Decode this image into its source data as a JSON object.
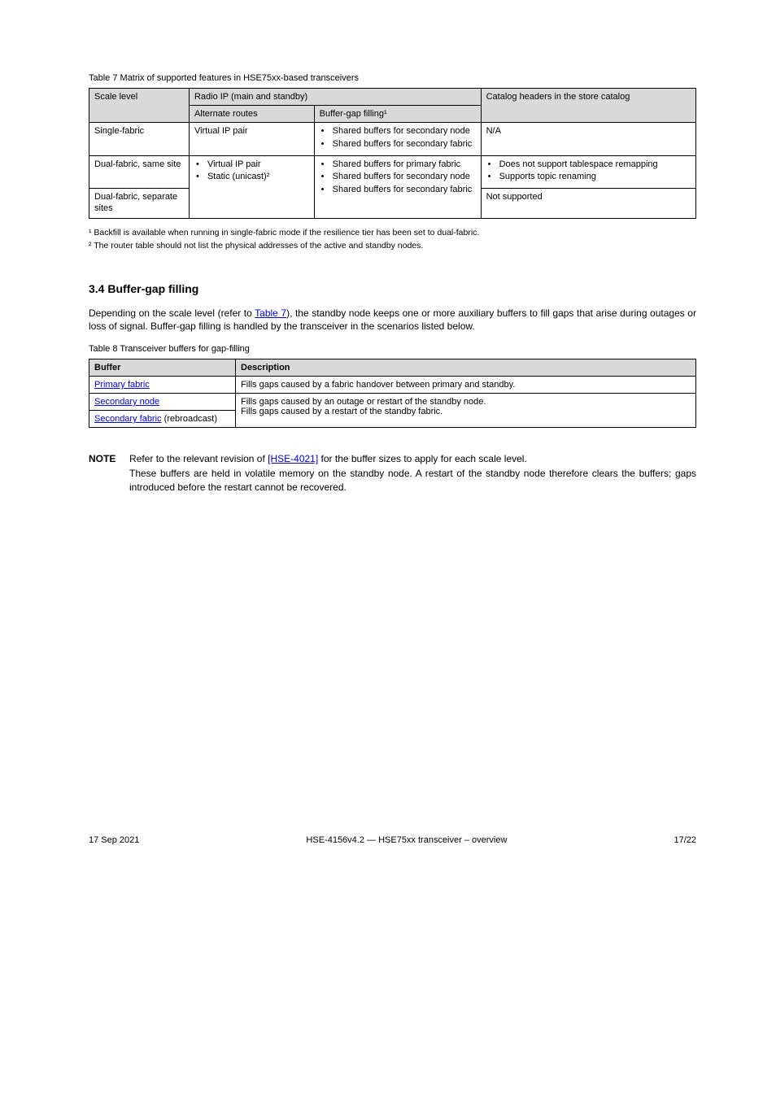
{
  "table7": {
    "caption": "Table 7 Matrix of supported features in HSE75xx-based transceivers",
    "headers": {
      "scale": "Scale level",
      "radio_group": "Radio IP (main and standby)",
      "alt_routes": "Alternate routes",
      "buf_gap": "Buffer-gap filling¹",
      "catalog_hdrs": "Catalog headers in the store catalog"
    },
    "rows": [
      {
        "scale": "Single-fabric",
        "alt_routes": "Virtual IP pair",
        "buf_gap_items": [
          "Shared buffers for secondary node",
          "Shared buffers for secondary fabric"
        ],
        "catalog": "N/A"
      },
      {
        "scale": "Dual-fabric, same site",
        "alt_routes_items": [
          "Virtual IP pair",
          "Static (unicast)²"
        ],
        "buf_gap_items": [
          "Shared buffers for primary fabric",
          "Shared buffers for secondary node",
          "Shared buffers for secondary fabric"
        ],
        "catalog_items": [
          "Does not support tablespace remapping",
          "Supports topic renaming"
        ]
      },
      {
        "scale": "Dual-fabric, separate sites",
        "catalog": "Not supported"
      }
    ]
  },
  "footnotes": {
    "fn1": "¹   Backfill is available when running in single-fabric mode if the resilience tier has been set to dual-fabric.",
    "fn2": "²   The router table should not list the physical addresses of the active and standby nodes."
  },
  "section": {
    "heading": "3.4   Buffer-gap filling",
    "p1_prefix": "Depending on the scale level (refer to ",
    "p1_link": "Table 7",
    "p1_suffix": "), the standby node keeps one or more auxiliary buffers to fill gaps that arise during outages or loss of signal. Buffer-gap filling is handled by the transceiver in the scenarios listed below."
  },
  "table8": {
    "caption": "Table 8 Transceiver buffers for gap-filling",
    "headers": {
      "buffer": "Buffer",
      "descr": "Description"
    },
    "rows": [
      {
        "buffer_link": "Primary fabric",
        "descr": "Fills gaps caused by a fabric handover between primary and standby."
      },
      {
        "buffer_link": "Secondary node",
        "descr_pre": "Fills gaps caused by an outage or restart of the standby node.",
        "buffer2_link": "Secondary fabric",
        "buffer2_suffix": " (rebroadcast)",
        "descr2": "Fills gaps caused by a restart of the standby fabric."
      }
    ]
  },
  "note": {
    "label": "NOTE",
    "lead": "Refer to the relevant revision of ",
    "link": "[HSE-4021]",
    "tail": " for the buffer sizes to apply for each scale level.",
    "para2": "These buffers are held in volatile memory on the standby node. A restart of the standby node therefore clears the buffers; gaps introduced before the restart cannot be recovered."
  },
  "footer": {
    "left": "17 Sep 2021",
    "center": "HSE-4156v4.2 — HSE75xx transceiver – overview",
    "right": "17/22"
  }
}
